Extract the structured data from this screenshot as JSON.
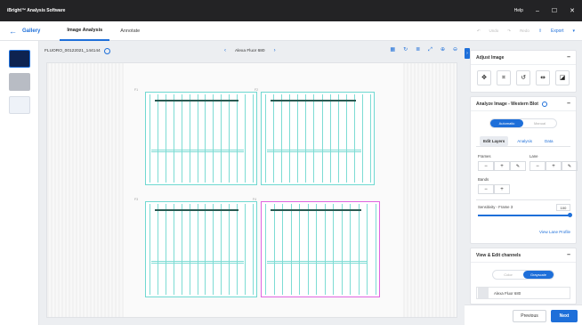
{
  "app": {
    "title": "iBright™ Analysis Software",
    "help": "Help"
  },
  "nav": {
    "gallery": "Gallery",
    "tabs": [
      {
        "label": "Image Analysis"
      },
      {
        "label": "Annotate"
      }
    ],
    "undo": "Undo",
    "redo": "Redo",
    "export": "Export"
  },
  "viewer": {
    "filename": "FLUORO_00122021_144144",
    "channel": "Alexa Fluor 680",
    "frames": [
      "F1",
      "F2",
      "F3",
      "F4"
    ]
  },
  "panel": {
    "adjust_title": "Adjust Image",
    "analyze_title": "Analyze Image - Western Blot",
    "mode": {
      "auto": "Automatic",
      "manual": "Manual"
    },
    "subtabs": [
      "Edit Layers",
      "Analysis",
      "Data"
    ],
    "frames_label": "Frames",
    "lanes_label": "Lane",
    "bands_label": "Bands",
    "sensitivity_label": "Sensitivity - Frame 3",
    "sensitivity_value": "100",
    "view_lane_profile": "View Lane Profile",
    "view_edit_title": "View & Edit channels",
    "channel_mode": {
      "color": "Color",
      "grayscale": "Grayscale"
    },
    "channel_name": "Alexa Fluor 680"
  },
  "footer": {
    "previous": "Previous",
    "next": "Next"
  },
  "colors": {
    "accent": "#1e6fd9",
    "lane": "#6fd8d1",
    "selected": "#e064e0",
    "titlebar": "#232325"
  }
}
